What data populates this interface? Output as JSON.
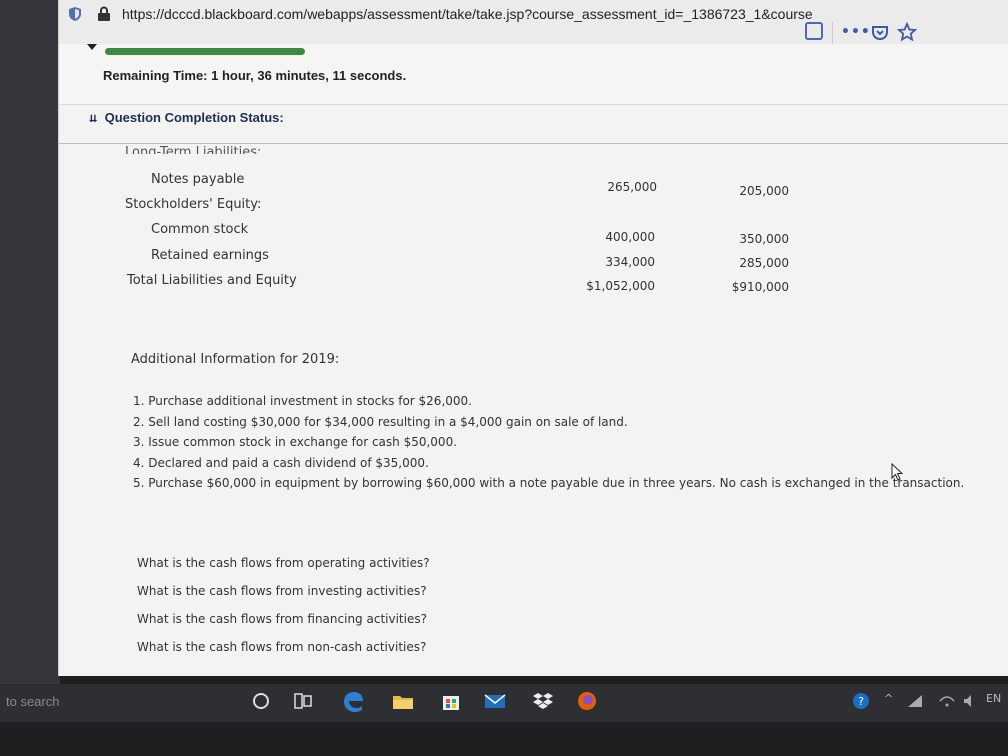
{
  "browser": {
    "url": "https://dcccd.blackboard.com/webapps/assessment/take/take.jsp?course_assessment_id=_1386723_1&course",
    "more_label": "•••"
  },
  "timer": {
    "label": "Remaining Time:",
    "value": "1 hour, 36 minutes, 11 seconds."
  },
  "question_status": {
    "label": "Question Completion Status:"
  },
  "balance_sheet": {
    "cut_heading": "Long-Term Liabilities:",
    "rows": [
      {
        "label": "Notes payable",
        "c1": "265,000",
        "c2": "205,000"
      },
      {
        "label": "Stockholders' Equity:",
        "c1": "",
        "c2": ""
      },
      {
        "label": "Common stock",
        "c1": "400,000",
        "c2": "350,000"
      },
      {
        "label": "Retained earnings",
        "c1": "334,000",
        "c2": "285,000"
      },
      {
        "label": "Total Liabilities and Equity",
        "c1": "$1,052,000",
        "c2": "$910,000"
      }
    ]
  },
  "additional": {
    "title": "Additional Information for 2019:",
    "items": [
      "1. Purchase additional investment in stocks for $26,000.",
      "2. Sell land costing $30,000 for $34,000 resulting in a $4,000 gain on sale of land.",
      "3. Issue common stock in exchange for cash $50,000.",
      "4. Declared and paid a cash dividend of $35,000.",
      "5. Purchase $60,000 in equipment by borrowing $60,000 with a note payable due in three years. No cash is exchanged in the transaction."
    ]
  },
  "questions": [
    "What is the cash flows from operating activities?",
    "What is the cash flows from investing activities?",
    "What is the cash flows from financing activities?",
    "What is the cash flows from non-cash activities?"
  ],
  "taskbar": {
    "search_text": "to search",
    "tray_lang": "EN"
  }
}
